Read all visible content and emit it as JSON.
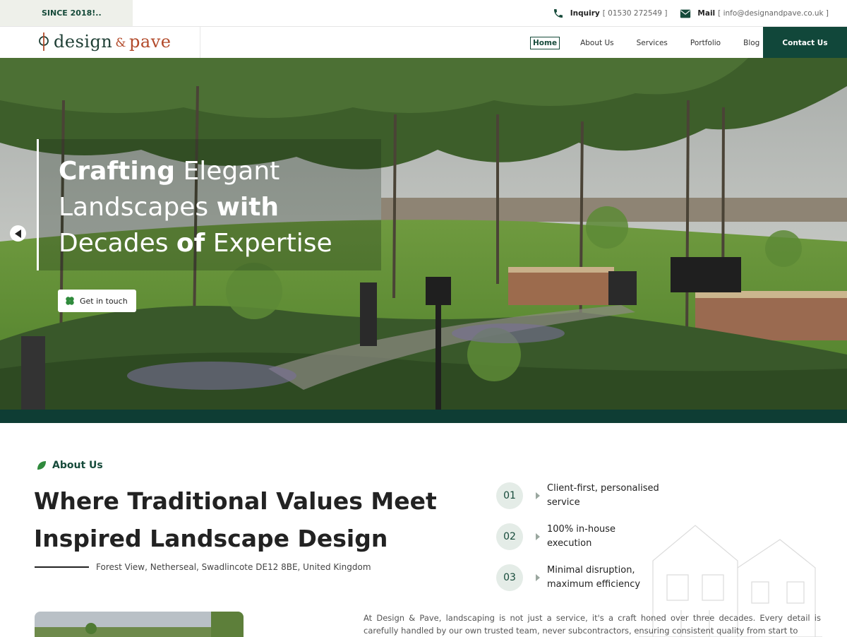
{
  "topbar": {
    "since": "SINCE 2018!..",
    "phone_label": "Inquiry",
    "phone_value": "[ 01530 272549 ]",
    "mail_label": "Mail",
    "mail_value": "[ info@designandpave.co.uk ]",
    "phone_icon": "phone-icon",
    "mail_icon": "mail-icon"
  },
  "header": {
    "logo_design": "design",
    "logo_amp": "&",
    "logo_pave": "pave",
    "nav": [
      "Home",
      "About Us",
      "Services",
      "Portfolio",
      "Blog"
    ],
    "active_nav": "Home",
    "contact_button": "Contact Us"
  },
  "hero": {
    "line1_bold": "Crafting",
    "line1_rest": " Elegant",
    "line2_normal": "Landscapes ",
    "line2_bold": "with",
    "line3_normal": "Decades ",
    "line3_bold": "of",
    "line3_rest": " Expertise",
    "cta_label": "Get in touch",
    "prev_icon": "chevron-left-icon"
  },
  "about": {
    "label": "About Us",
    "title_line1": "Where Traditional Values Meet",
    "title_line2": "Inspired Landscape Design",
    "address": "Forest View, Netherseal, Swadlincote DE12 8BE, United Kingdom",
    "features": [
      {
        "num": "01",
        "line1": "Client-first, personalised",
        "line2": "service"
      },
      {
        "num": "02",
        "line1": "100% in-house",
        "line2": "execution"
      },
      {
        "num": "03",
        "line1": "Minimal disruption,",
        "line2": "maximum efficiency"
      }
    ],
    "paragraph": "At Design & Pave, landscaping is not just a service, it's a craft honed over three decades. Every detail is carefully handled by our own trusted team, never subcontractors, ensuring consistent quality from start to"
  },
  "colors": {
    "brand_green": "#11473a",
    "accent_red": "#b24a2a",
    "light_green": "#e4ece7"
  }
}
